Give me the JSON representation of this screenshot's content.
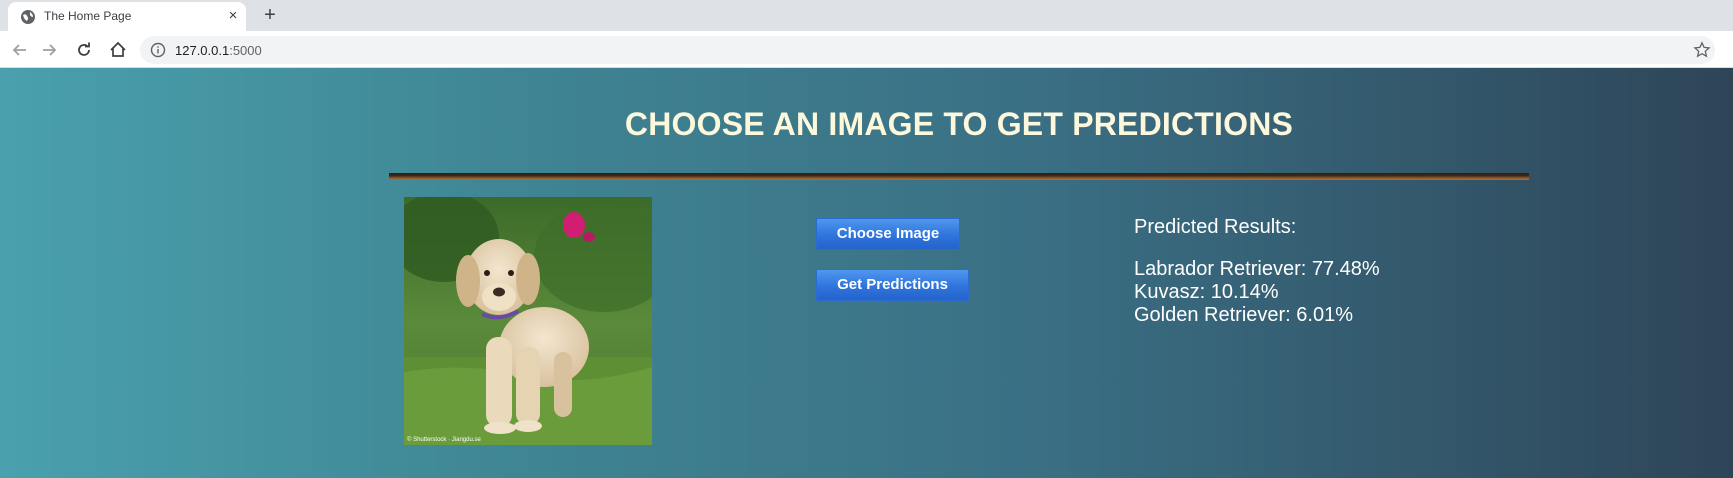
{
  "browser": {
    "tab": {
      "title": "The Home Page",
      "favicon": "globe-icon",
      "close_icon": "×"
    },
    "new_tab_icon": "+",
    "url": {
      "host": "127.0.0.1",
      "port": ":5000"
    }
  },
  "page": {
    "title": "CHOOSE AN IMAGE TO GET PREDICTIONS",
    "image": {
      "subject": "labrador-puppy-photo",
      "credit": "© Shutterstock · Jiangdu.se"
    },
    "buttons": {
      "choose_image": "Choose Image",
      "get_predictions": "Get Predictions"
    },
    "results": {
      "heading": "Predicted Results:",
      "items": [
        {
          "label": "Labrador Retriever: 77.48%"
        },
        {
          "label": "Kuvasz: 10.14%"
        },
        {
          "label": "Golden Retriever: 6.01%"
        }
      ]
    }
  },
  "colors": {
    "title": "#fdf7dc",
    "button": "#2f74dc",
    "text": "#ffffff"
  }
}
